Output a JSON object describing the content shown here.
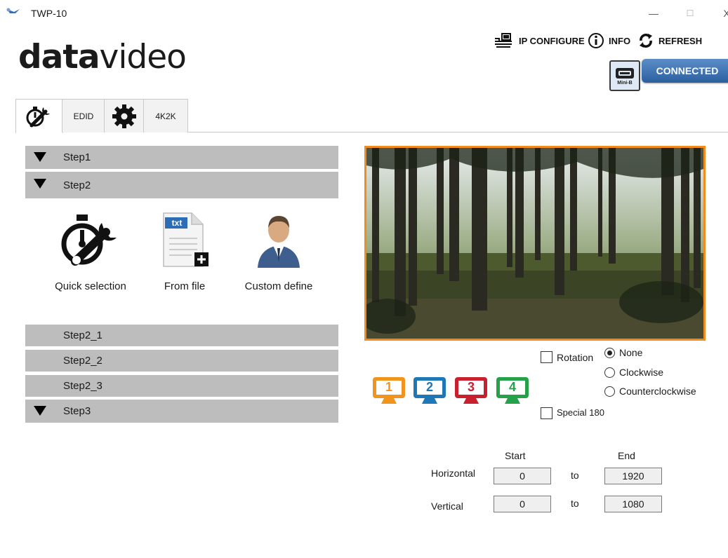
{
  "window": {
    "title": "TWP-10",
    "min": "—",
    "max": "☐",
    "close": "X"
  },
  "logo": {
    "part1": "data",
    "part2": "video"
  },
  "toplinks": {
    "ip_configure": "IP CONFIGURE",
    "info": "INFO",
    "refresh": "REFRESH"
  },
  "status": {
    "usb_label": "Mini-B",
    "connection": "CONNECTED"
  },
  "tabs": [
    {
      "label": ""
    },
    {
      "label": "EDID"
    },
    {
      "label": ""
    },
    {
      "label": "4K2K"
    }
  ],
  "steps": {
    "step1": "Step1",
    "step2": "Step2",
    "step2_1": "Step2_1",
    "step2_2": "Step2_2",
    "step2_3": "Step2_3",
    "step3": "Step3"
  },
  "options": {
    "quick": "Quick selection",
    "file": "From file",
    "file_badge": "txt",
    "custom": "Custom define"
  },
  "monitors": [
    {
      "num": "1",
      "color": "#f0941e"
    },
    {
      "num": "2",
      "color": "#1e78b7"
    },
    {
      "num": "3",
      "color": "#c8202e"
    },
    {
      "num": "4",
      "color": "#25a249"
    }
  ],
  "rotation": {
    "label": "Rotation",
    "checked": false,
    "options": [
      "None",
      "Clockwise",
      "Counterclockwise"
    ],
    "selected": "None"
  },
  "special180": {
    "label": "Special 180",
    "checked": false
  },
  "crop": {
    "start_header": "Start",
    "end_header": "End",
    "horizontal": {
      "label": "Horizontal",
      "start": "0",
      "to": "to",
      "end": "1920"
    },
    "vertical": {
      "label": "Vertical",
      "start": "0",
      "to": "to",
      "end": "1080"
    }
  },
  "colors": {
    "accent_orange": "#f28c1e",
    "connected_blue": "#2a5f9f",
    "step_gray": "#bdbdbd"
  }
}
